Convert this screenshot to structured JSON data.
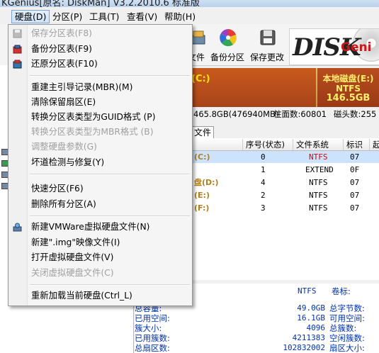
{
  "window": {
    "title": "KGenius[原名: DiskMan] V3.2.2010.6 标准版"
  },
  "menubar": [
    {
      "label": "硬盘(D)"
    },
    {
      "label": "分区(P)"
    },
    {
      "label": "工具(T)"
    },
    {
      "label": "查看(V)"
    },
    {
      "label": "帮助(H)"
    }
  ],
  "toolbar": {
    "buttons": [
      {
        "label": "文件"
      },
      {
        "label": "备份分区"
      },
      {
        "label": "保存更改"
      }
    ],
    "logo_text": "DISK",
    "logo_suffix": "Geni"
  },
  "disk_bar": {
    "c_label": "(C:)",
    "e_name": "本地磁盘(E:)",
    "e_fs": "NTFS",
    "e_size": "146.5GB"
  },
  "info_strip": {
    "capacity": "465.8GB(476940MB)",
    "cylinders": "柱面数:60801",
    "heads": "磁头数:255"
  },
  "tabs": [
    {
      "label": "文件"
    }
  ],
  "partition_table": {
    "headers": [
      "序号(状态)",
      "文件系统",
      "标识",
      "起"
    ],
    "rows": [
      {
        "name": "(C:)",
        "index": "0",
        "fs": "NTFS",
        "id": "07",
        "selected": true
      },
      {
        "name": "",
        "index": "1",
        "fs": "EXTEND",
        "id": "0F",
        "selected": false
      },
      {
        "name": "盘(D:)",
        "index": "4",
        "fs": "NTFS",
        "id": "07",
        "selected": false
      },
      {
        "name": "(E:)",
        "index": "2",
        "fs": "NTFS",
        "id": "07",
        "selected": false
      },
      {
        "name": "(F:)",
        "index": "3",
        "fs": "NTFS",
        "id": "07",
        "selected": false
      }
    ]
  },
  "detail": {
    "fs_value": "NTFS",
    "volume_label": "卷标:",
    "rows": [
      {
        "label": "总容量:",
        "value": "49.0GB",
        "label2": "总字节数:"
      },
      {
        "label": "已用空间:",
        "value": "16.1GB",
        "label2": "可用空间:"
      },
      {
        "label": "簇大小:",
        "value": "4096",
        "label2": "总簇数:"
      },
      {
        "label": "已用簇数:",
        "value": "4211383",
        "label2": "空闲簇数:"
      },
      {
        "label": "总扇区数:",
        "value": "102832002",
        "label2": "扇区大小:"
      }
    ]
  },
  "disk_menu": {
    "items": [
      {
        "label": "保存分区表(F8)",
        "disabled": true,
        "icon": "save-icon"
      },
      {
        "label": "备份分区表(F9)",
        "disabled": false,
        "icon": "backup-icon"
      },
      {
        "label": "还原分区表(F10)",
        "disabled": false,
        "icon": "restore-icon"
      },
      {
        "label": "重建主引导记录(MBR)(M)",
        "disabled": false
      },
      {
        "label": "清除保留扇区(E)",
        "disabled": false
      },
      {
        "label": "转换分区表类型为GUID格式 (P)",
        "disabled": false
      },
      {
        "label": "转换分区表类型为MBR格式 (B)",
        "disabled": true
      },
      {
        "label": "调整硬盘参数(G)",
        "disabled": true
      },
      {
        "label": "坏道检测与修复(Y)",
        "disabled": false
      },
      {
        "label": "快速分区(F6)",
        "disabled": false
      },
      {
        "label": "删除所有分区(A)",
        "disabled": false
      },
      {
        "label": "新建VMWare虚拟硬盘文件(N)",
        "disabled": false,
        "icon": "vmware-icon"
      },
      {
        "label": "新建\".img\"映像文件(I)",
        "disabled": false
      },
      {
        "label": "打开虚拟硬盘文件(V)",
        "disabled": false
      },
      {
        "label": "关闭虚拟硬盘文件(C)",
        "disabled": true
      },
      {
        "label": "重新加载当前硬盘(Ctrl_L)",
        "disabled": false
      }
    ]
  },
  "colors": {
    "menu_bg": "#f5f5f5",
    "disabled_text": "#a0a0a0",
    "partition_name": "#b0801c",
    "ntfs_red": "#e00000",
    "detail_blue": "#0033aa"
  }
}
